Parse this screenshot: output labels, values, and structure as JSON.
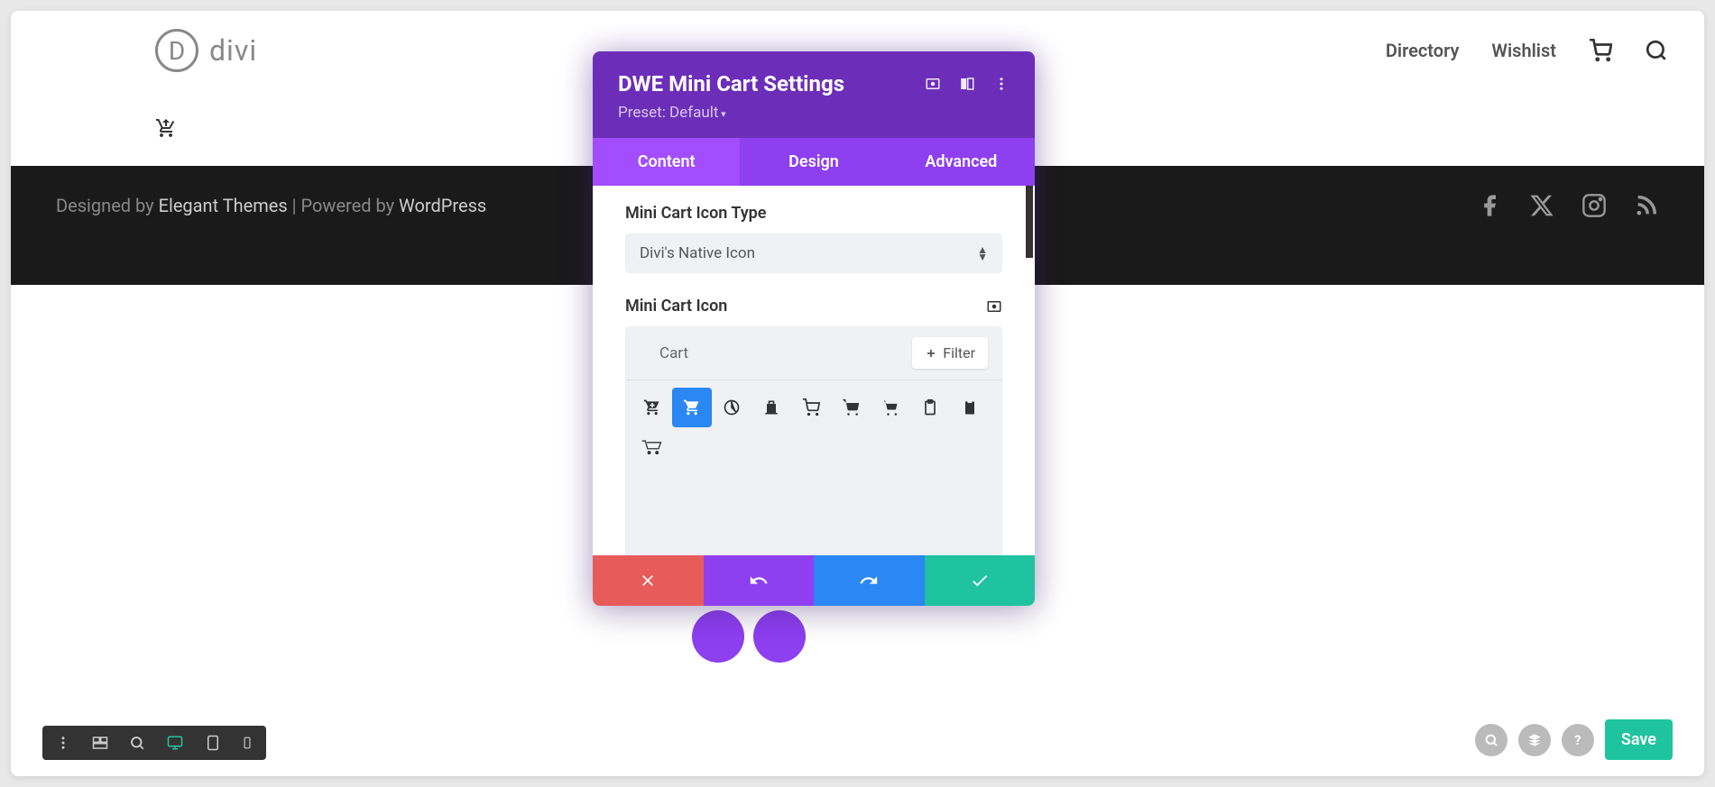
{
  "header": {
    "logo_letter": "D",
    "logo_text": "divi",
    "nav": {
      "directory": "Directory",
      "wishlist": "Wishlist"
    }
  },
  "footer": {
    "prefix": "Designed by ",
    "elegant": "Elegant Themes",
    "middle": " | Powered by ",
    "wp": "WordPress"
  },
  "modal": {
    "title": "DWE Mini Cart Settings",
    "preset": "Preset: Default",
    "tabs": {
      "content": "Content",
      "design": "Design",
      "advanced": "Advanced"
    },
    "fields": {
      "icon_type_label": "Mini Cart Icon Type",
      "icon_type_value": "Divi's Native Icon",
      "icon_label": "Mini Cart Icon",
      "search_value": "Cart",
      "filter_label": "Filter"
    }
  },
  "bottom": {
    "save": "Save"
  }
}
